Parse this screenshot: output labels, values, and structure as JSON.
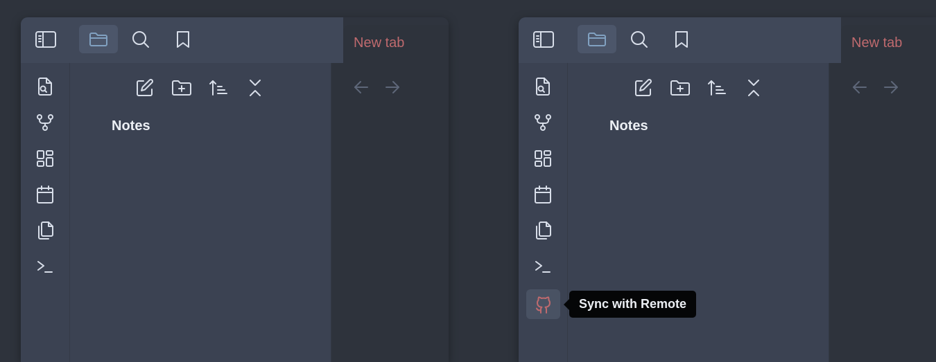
{
  "windows": [
    {
      "id": "left",
      "tab_title": "New tab",
      "folder_title": "Notes",
      "header_icons": [
        "sidebar-toggle-icon",
        "folder-icon",
        "search-icon",
        "bookmark-icon"
      ],
      "explorer_actions": [
        "new-note-icon",
        "new-folder-icon",
        "sort-icon",
        "collapse-all-icon"
      ],
      "ribbon_icons": [
        "file-search-icon",
        "graph-icon",
        "dashboard-icon",
        "calendar-icon",
        "copy-icon",
        "terminal-icon"
      ]
    },
    {
      "id": "right",
      "tab_title": "New tab",
      "folder_title": "Notes",
      "header_icons": [
        "sidebar-toggle-icon",
        "folder-icon",
        "search-icon",
        "bookmark-icon"
      ],
      "explorer_actions": [
        "new-note-icon",
        "new-folder-icon",
        "sort-icon",
        "collapse-all-icon"
      ],
      "ribbon_icons": [
        "file-search-icon",
        "graph-icon",
        "dashboard-icon",
        "calendar-icon",
        "copy-icon",
        "terminal-icon",
        "github-icon"
      ],
      "tooltip": "Sync with Remote"
    }
  ],
  "colors": {
    "background": "#2e333c",
    "header": "#404859",
    "sidebar": "#3b4252",
    "accent_red": "#bf6a6e",
    "accent_blue": "#81a1c1",
    "tooltip_bg": "#050607"
  }
}
